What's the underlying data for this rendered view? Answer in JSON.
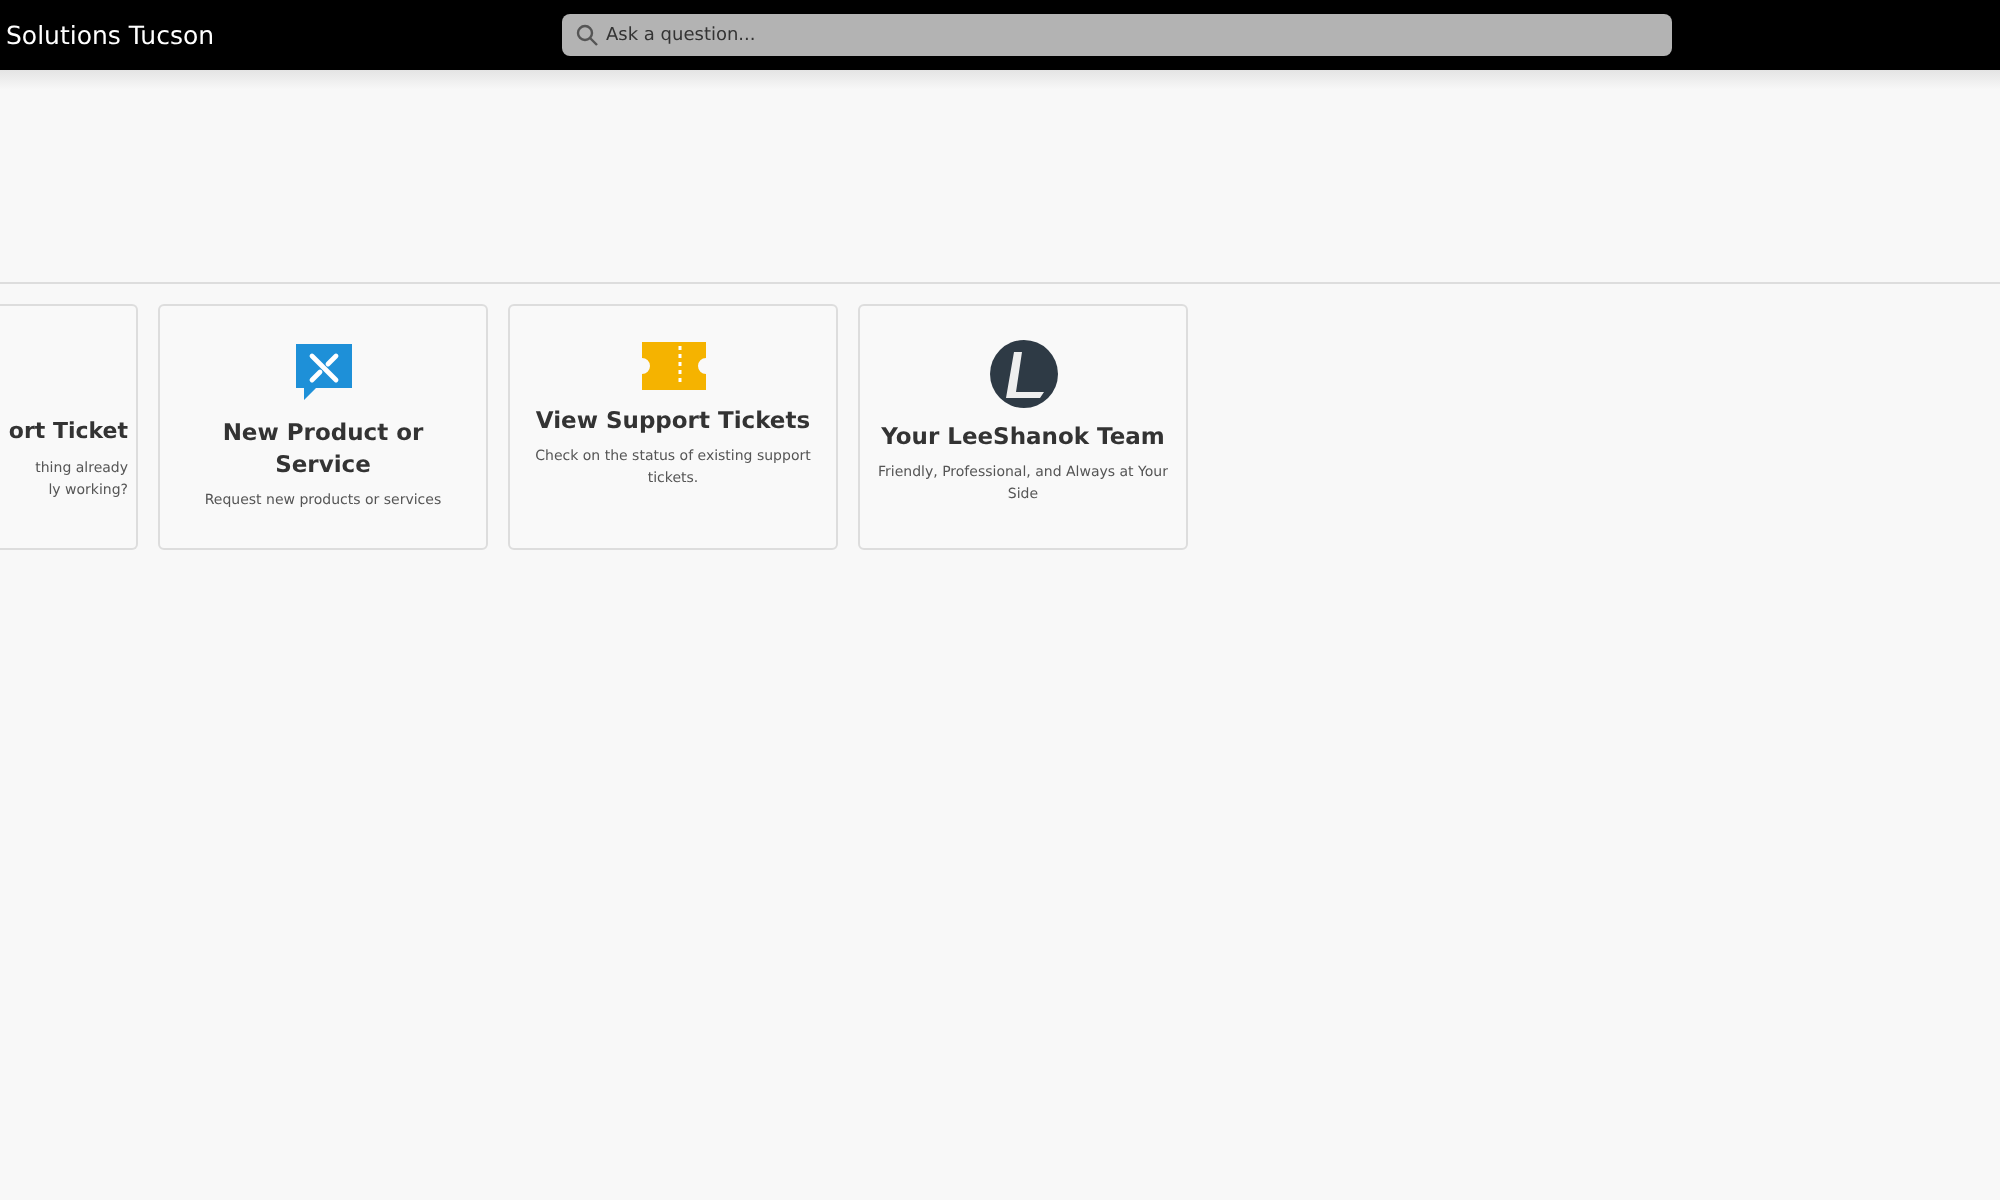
{
  "header": {
    "brand": "Solutions Tucson",
    "search": {
      "placeholder": "Ask a question..."
    }
  },
  "cards": [
    {
      "kind": "cut",
      "title": "ort Ticket",
      "description": "thing already\nly working?"
    },
    {
      "kind": "tools",
      "title": "New Product or Service",
      "description": "Request new products or services"
    },
    {
      "kind": "ticket",
      "title": "View Support Tickets",
      "description": "Check on the status of existing support tickets."
    },
    {
      "kind": "logo",
      "title": "Your LeeShanok Team",
      "description": "Friendly, Professional, and Always at Your Side"
    }
  ]
}
